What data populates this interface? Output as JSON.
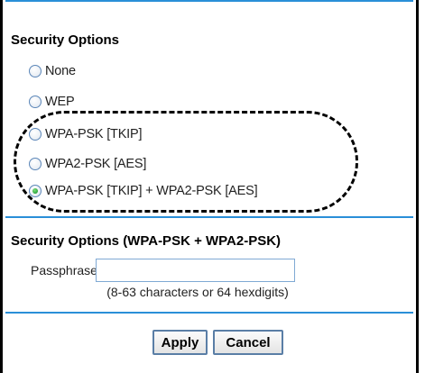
{
  "security_options": {
    "heading": "Security Options",
    "options": [
      {
        "label": "None",
        "checked": false
      },
      {
        "label": "WEP",
        "checked": false
      },
      {
        "label": "WPA-PSK [TKIP]",
        "checked": false
      },
      {
        "label": "WPA2-PSK [AES]",
        "checked": false
      },
      {
        "label": "WPA-PSK [TKIP] + WPA2-PSK [AES]",
        "checked": true
      }
    ]
  },
  "wpa_section": {
    "heading": "Security Options (WPA-PSK + WPA2-PSK)",
    "passphrase_label": "Passphrase:",
    "passphrase_value": "",
    "hint": "(8-63 characters or 64 hexdigits)"
  },
  "buttons": {
    "apply": "Apply",
    "cancel": "Cancel"
  },
  "colors": {
    "divider": "#2a8fd8",
    "selected_radio": "#2aa43a"
  }
}
